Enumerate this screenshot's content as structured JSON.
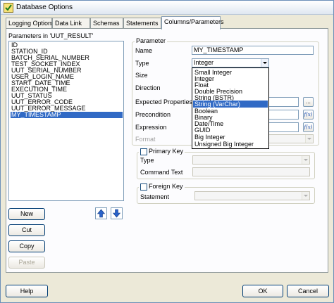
{
  "window": {
    "title": "Database Options",
    "icon": "database-options-icon"
  },
  "tabs": [
    {
      "label": "Logging Options",
      "active": false
    },
    {
      "label": "Data Link",
      "active": false
    },
    {
      "label": "Schemas",
      "active": false
    },
    {
      "label": "Statements",
      "active": false
    },
    {
      "label": "Columns/Parameters",
      "active": true
    }
  ],
  "parameters_list": {
    "label": "Parameters in 'UUT_RESULT'",
    "items": [
      "ID",
      "STATION_ID",
      "BATCH_SERIAL_NUMBER",
      "TEST_SOCKET_INDEX",
      "UUT_SERIAL_NUMBER",
      "USER_LOGIN_NAME",
      "START_DATE_TIME",
      "EXECUTION_TIME",
      "UUT_STATUS",
      "UUT_ERROR_CODE",
      "UUT_ERROR_MESSAGE",
      "MY_TIMESTAMP"
    ],
    "selected_index": 11
  },
  "list_buttons": {
    "new": "New",
    "cut": "Cut",
    "copy": "Copy",
    "paste": "Paste",
    "move_up_icon": "blue-up-arrow-icon",
    "move_down_icon": "blue-down-arrow-icon"
  },
  "parameter_group": {
    "title": "Parameter",
    "name_label": "Name",
    "name_value": "MY_TIMESTAMP",
    "type_label": "Type",
    "type_value": "Integer",
    "size_label": "Size",
    "direction_label": "Direction",
    "expected_properties_label": "Expected Properties",
    "precondition_label": "Precondition",
    "expression_label": "Expression",
    "format_label": "Format",
    "browse_label": "...",
    "fx_label": "f(x)"
  },
  "type_dropdown": {
    "options": [
      "Small Integer",
      "Integer",
      "Float",
      "Double Precision",
      "String (BSTR)",
      "String (VarChar)",
      "Boolean",
      "Binary",
      "Date/Time",
      "GUID",
      "Big Integer",
      "Unsigned Big Integer"
    ],
    "highlighted_index": 5
  },
  "primary_key_group": {
    "title": "Primary Key",
    "checked": false,
    "type_label": "Type",
    "command_text_label": "Command Text"
  },
  "foreign_key_group": {
    "title": "Foreign Key",
    "checked": false,
    "statement_label": "Statement"
  },
  "dialog_buttons": {
    "help": "Help",
    "ok": "OK",
    "cancel": "Cancel"
  },
  "colors": {
    "selection": "#316ac5",
    "fx_blue": "#1a4fb3",
    "window_border": "#6b8fb8"
  }
}
